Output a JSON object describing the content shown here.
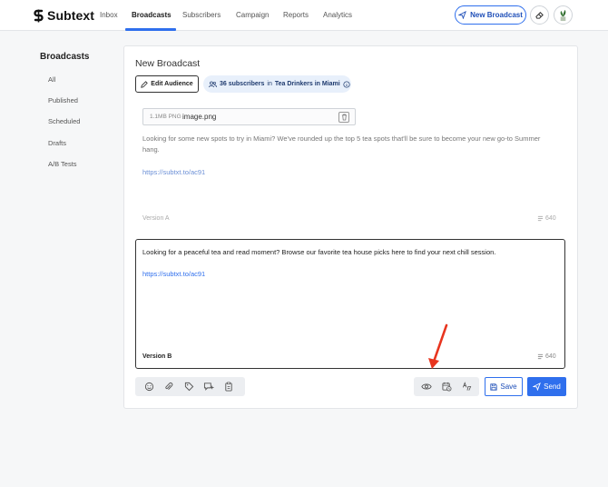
{
  "brand": {
    "name": "Subtext"
  },
  "nav": {
    "items": [
      {
        "label": "Inbox",
        "active": false
      },
      {
        "label": "Broadcasts",
        "active": true
      },
      {
        "label": "Subscribers",
        "active": false
      },
      {
        "label": "Campaign",
        "active": false
      },
      {
        "label": "Reports",
        "active": false
      },
      {
        "label": "Analytics",
        "active": false
      }
    ],
    "new_broadcast_label": "New Broadcast",
    "accent_color": "#2f6fed"
  },
  "sidebar": {
    "title": "Broadcasts",
    "items": [
      {
        "label": "All"
      },
      {
        "label": "Published"
      },
      {
        "label": "Scheduled"
      },
      {
        "label": "Drafts"
      },
      {
        "label": "A/B Tests"
      }
    ]
  },
  "editor": {
    "title": "New Broadcast",
    "edit_audience_label": "Edit Audience",
    "audience": {
      "count_text": "36 subscribers",
      "connector": "in",
      "segment": "Tea Drinkers in Miami"
    },
    "version_a": {
      "attachment_size": "1.1MB PNG",
      "attachment_name": "image.png",
      "message": "Looking for some new spots to try in Miami? We've rounded up the top 5 tea spots that'll be sure to become your new go-to Summer hang.",
      "link": "https://subtxt.to/ac91",
      "label": "Version A",
      "char_count": "640"
    },
    "version_b": {
      "message": "Looking for a peaceful tea and read moment? Browse our favorite tea house picks here to find your next chill session.",
      "link": "https://subtxt.to/ac91",
      "label": "Version B",
      "char_count": "640"
    },
    "toolbar_left_icons": [
      "emoji-icon",
      "paperclip-icon",
      "tag-icon",
      "chat-plus-icon",
      "clipboard-icon"
    ],
    "toolbar_right_icons": [
      "eye-icon",
      "calendar-clock-icon",
      "translate-icon"
    ],
    "save_label": "Save",
    "send_label": "Send"
  }
}
